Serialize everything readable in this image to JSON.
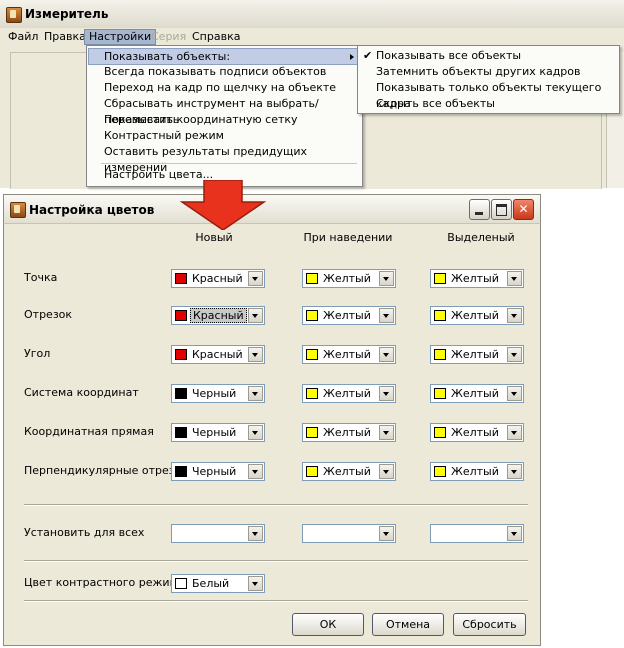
{
  "main_window": {
    "title": "Измеритель",
    "menu": [
      "Файл",
      "Правка",
      "Настройки",
      "Серия",
      "Справка"
    ]
  },
  "settings_menu": {
    "items": [
      "Показывать объекты:",
      "Всегда показывать подписи объектов",
      "Переход на кадр по щелчку на объекте",
      "Сбрасывать инструмент на выбрать/переместить",
      "Показывать координатную сетку",
      "Контрастный режим",
      "Оставить результаты предидущих измерений",
      "Настроить цвета..."
    ]
  },
  "objects_submenu": {
    "items": [
      "Показывать все объекты",
      "Затемнить объекты других кадров",
      "Показывать только  объекты текущего кадра",
      "Скрыть все объекты"
    ],
    "checked_index": 0
  },
  "dialog": {
    "title": "Настройка цветов",
    "columns": [
      "Новый",
      "При наведении",
      "Выделеный"
    ],
    "rows": [
      {
        "label": "Точка",
        "values": [
          "Красный",
          "Желтый",
          "Желтый"
        ]
      },
      {
        "label": "Отрезок",
        "values": [
          "Красный",
          "Желтый",
          "Желтый"
        ]
      },
      {
        "label": "Угол",
        "values": [
          "Красный",
          "Желтый",
          "Желтый"
        ]
      },
      {
        "label": "Система координат",
        "values": [
          "Черный",
          "Желтый",
          "Желтый"
        ]
      },
      {
        "label": "Координатная прямая",
        "values": [
          "Черный",
          "Желтый",
          "Желтый"
        ]
      },
      {
        "label": "Перпендикулярные отрезки",
        "values": [
          "Черный",
          "Желтый",
          "Желтый"
        ]
      }
    ],
    "set_all_label": "Установить для всех",
    "contrast_label": "Цвет контрастного режима",
    "contrast_value": "Белый",
    "buttons": {
      "ok": "ОК",
      "cancel": "Отмена",
      "reset": "Сбросить"
    }
  },
  "colors": {
    "Красный": "#e00000",
    "Желтый": "#ffff00",
    "Черный": "#000000",
    "Белый": "#ffffff",
    "arrow": "#e8321e",
    "menu_highlight": "#c1cde4"
  }
}
